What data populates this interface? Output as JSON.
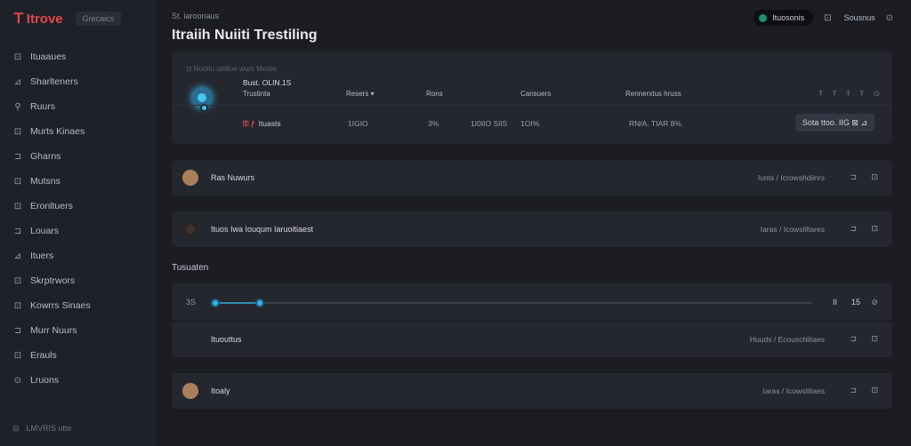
{
  "brand": {
    "logo_glyph": "𝖳",
    "name": "Itrove",
    "tag": "Grecaics"
  },
  "sidebar": {
    "items": [
      {
        "icon": "⊡",
        "label": "Ituaaues"
      },
      {
        "icon": "⊿",
        "label": "Sharlteners"
      },
      {
        "icon": "⚲",
        "label": "Ruurs"
      },
      {
        "icon": "⊡",
        "label": "Murts Kinaes"
      },
      {
        "icon": "⊐",
        "label": "Gharns"
      },
      {
        "icon": "⊡",
        "label": "Mutsns"
      },
      {
        "icon": "⊡",
        "label": "Eronltuers"
      },
      {
        "icon": "⊐",
        "label": "Louars"
      },
      {
        "icon": "⊿",
        "label": "Ituers"
      },
      {
        "icon": "⊡",
        "label": "Skrptrwors"
      },
      {
        "icon": "⊡",
        "label": "Kowrrs Sinaes"
      },
      {
        "icon": "⊐",
        "label": "Murr Nuurs"
      },
      {
        "icon": "⊡",
        "label": "Erauls"
      },
      {
        "icon": "⊙",
        "label": "Lruons"
      }
    ],
    "footer_icon": "⊟",
    "footer_text": "LMVRIS utte"
  },
  "header": {
    "crumb": "St. iaroonaus",
    "title": "Itraiih Nuiiti Trestiling",
    "actions": {
      "pill_label": "Ituosonis",
      "icon1": "⊡",
      "link": "Sousnus",
      "icon2": "⊙"
    }
  },
  "main_card": {
    "hint": "⊡ Nuoitu uinltoe wurs Mosiis",
    "name": "Bust. OLIN.1S",
    "columns": [
      "Trustinta",
      "Resers ▾",
      "Rons",
      "Cansuers",
      "Rennerxtus hruss"
    ],
    "mini_icons": [
      "⍒",
      "⍒",
      "⍒",
      "⍒",
      "⊙"
    ],
    "row": {
      "status_icon": "⚿",
      "status_code": "ƒ",
      "status_text": "Ituasts",
      "v1": "1IGIO",
      "v2": "3%",
      "v3": "1I0IIO SIlS",
      "v4": "1OI%",
      "v5": "RN/A. TIAR  8%"
    },
    "row_button": "Sota ttoo. IIG  ⊠ ⊿"
  },
  "rows_top": [
    {
      "title": "Ras Nuwurs",
      "meta": "Iunts / Icrowshdiinrs",
      "icon1": "⊐",
      "icon2": "⊡"
    },
    {
      "title": "Ituos Iwa Iouqum Iaruoitiaest",
      "meta": "Iaras / Icowsliltares",
      "icon1": "⊐",
      "icon2": "⊡"
    }
  ],
  "section_label": "Tusuaten",
  "slider": {
    "left_label": "3S",
    "progress": 0.078,
    "r1": "II",
    "r2": "15",
    "r3": "⊘"
  },
  "rows_bottom": [
    {
      "title": "Ituouttus",
      "meta": "Huuds / Ecouschlitaes",
      "icon1": "⊐",
      "icon2": "⊡",
      "has_face": false
    },
    {
      "title": "Itoaly",
      "meta": "Iaras / Icowsliltaes",
      "icon1": "⊐",
      "icon2": "⊡",
      "has_face": true
    }
  ],
  "colors": {
    "accent": "#36b4e4",
    "brand": "#e2474d",
    "bg": "#1b1d23",
    "card": "#25272f"
  }
}
